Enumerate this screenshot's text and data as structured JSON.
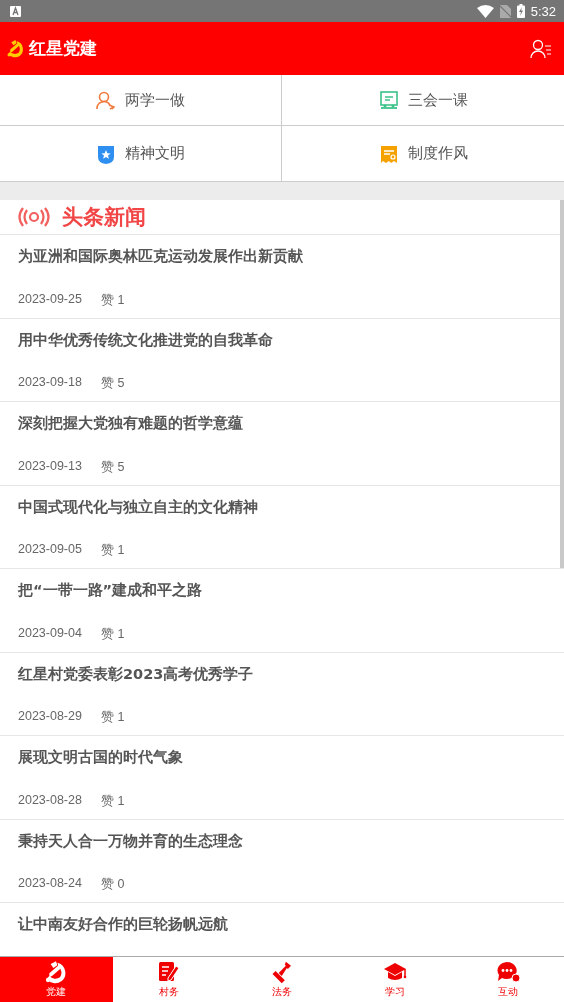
{
  "status_bar": {
    "time": "5:32"
  },
  "header": {
    "title": "红星党建"
  },
  "shortcuts": [
    {
      "label": "两学一做",
      "kind": "person"
    },
    {
      "label": "三会一课",
      "kind": "board"
    },
    {
      "label": "精神文明",
      "kind": "shield"
    },
    {
      "label": "制度作风",
      "kind": "certificate"
    }
  ],
  "section": {
    "title": "头条新闻"
  },
  "news": [
    {
      "title": "为亚洲和国际奥林匹克运动发展作出新贡献",
      "date": "2023-09-25",
      "likes": "赞 1"
    },
    {
      "title": "用中华优秀传统文化推进党的自我革命",
      "date": "2023-09-18",
      "likes": "赞 5"
    },
    {
      "title": "深刻把握大党独有难题的哲学意蕴",
      "date": "2023-09-13",
      "likes": "赞 5"
    },
    {
      "title": "中国式现代化与独立自主的文化精神",
      "date": "2023-09-05",
      "likes": "赞 1"
    },
    {
      "title": "把“一带一路”建成和平之路",
      "date": "2023-09-04",
      "likes": "赞 1"
    },
    {
      "title": "红星村党委表彰2023高考优秀学子",
      "date": "2023-08-29",
      "likes": "赞 1"
    },
    {
      "title": "展现文明古国的时代气象",
      "date": "2023-08-28",
      "likes": "赞 1"
    },
    {
      "title": "秉持天人合一万物并育的生态理念",
      "date": "2023-08-24",
      "likes": "赞 0"
    },
    {
      "title": "让中南友好合作的巨轮扬帆远航"
    }
  ],
  "nav": [
    {
      "label": "党建",
      "kind": "party",
      "selected": true
    },
    {
      "label": "村务",
      "kind": "notepad",
      "selected": false
    },
    {
      "label": "法务",
      "kind": "stamp",
      "selected": false
    },
    {
      "label": "学习",
      "kind": "cap",
      "selected": false
    },
    {
      "label": "互动",
      "kind": "chat",
      "selected": false
    }
  ]
}
